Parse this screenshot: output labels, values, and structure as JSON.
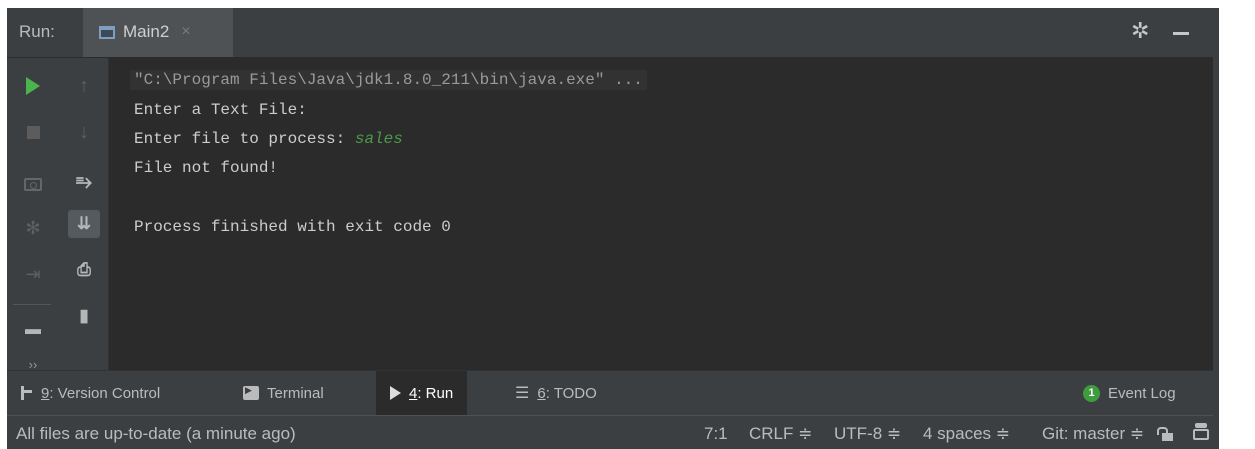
{
  "header": {
    "run_label": "Run:",
    "tab_label": "Main2",
    "tab_close": "×"
  },
  "left_toolbar": {
    "icons": [
      "run-icon",
      "stop-icon",
      "camera-icon",
      "debug-icon",
      "exit-icon",
      "layout-icon",
      "more-icon"
    ],
    "more": "››"
  },
  "secondary_toolbar": {
    "icons": [
      "up-arrow-icon",
      "down-arrow-icon",
      "soft-wrap-icon",
      "scroll-to-end-icon",
      "print-icon",
      "trash-icon"
    ]
  },
  "console": {
    "command": "\"C:\\Program Files\\Java\\jdk1.8.0_211\\bin\\java.exe\" ...",
    "line1": "Enter a Text File:",
    "line2_prompt": "Enter file to process: ",
    "line2_input": "sales",
    "line3": "File not found!",
    "line4": "Process finished with exit code 0"
  },
  "tool_windows": {
    "version_control": {
      "key": "9",
      "label": ": Version Control"
    },
    "terminal": {
      "label": "Terminal"
    },
    "run": {
      "key": "4",
      "label": ": Run"
    },
    "todo": {
      "key": "6",
      "label": ": TODO"
    },
    "event_log": {
      "badge": "1",
      "label": "Event Log"
    }
  },
  "status_bar": {
    "message": "All files are up-to-date (a minute ago)",
    "position": "7:1",
    "line_sep": "CRLF ≑",
    "encoding": "UTF-8 ≑",
    "indent": "4 spaces ≑",
    "git": "Git: master ≑"
  },
  "colors": {
    "background": "#2b2b2b",
    "panel": "#3c3f41",
    "run_green": "#4db34d",
    "input_green": "#4a9a4a"
  }
}
